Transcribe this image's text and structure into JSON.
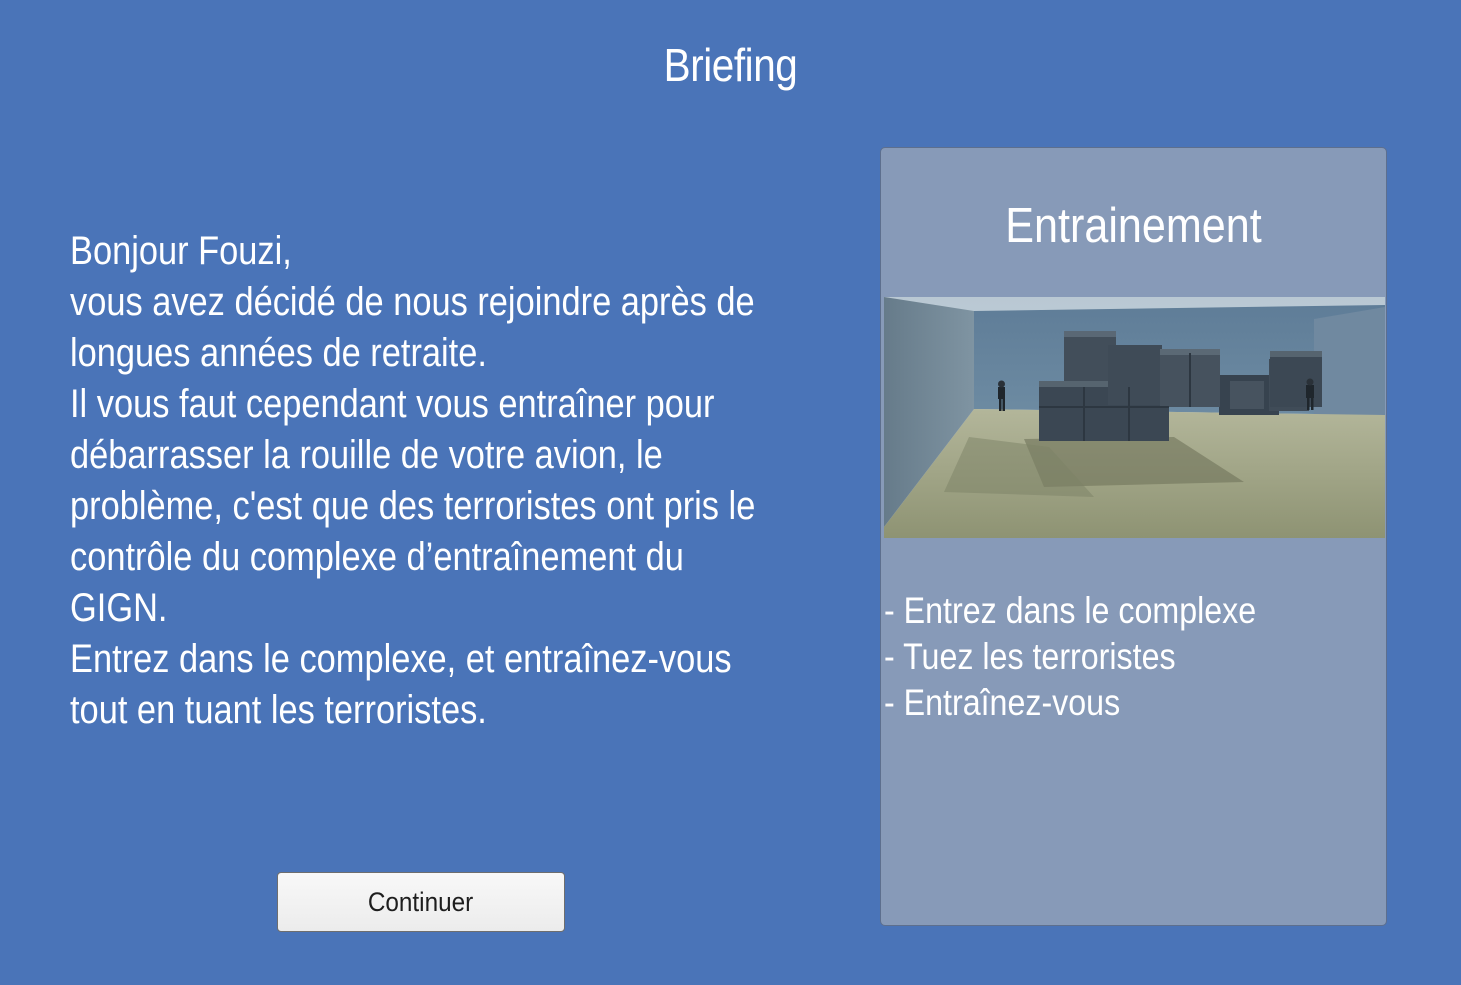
{
  "screen": {
    "title": "Briefing"
  },
  "briefing": {
    "text": "Bonjour Fouzi,\n vous avez décidé de nous rejoindre après de longues années de retraite.\nIl vous faut cependant vous entraîner pour débarrasser la rouille de votre avion, le problème, c'est que des terroristes ont pris le contrôle du complexe d’entraînement du GIGN.\nEntrez dans le complexe, et entraînez-vous tout en tuant les terroristes."
  },
  "continue_button": {
    "label": "Continuer"
  },
  "mission": {
    "title": "Entrainement",
    "image_icon": "training-complex-preview",
    "objectives": [
      "- Entrez dans le complexe",
      "- Tuez les terroristes",
      "- Entraînez-vous"
    ]
  },
  "colors": {
    "background": "#4a74b8",
    "panel": "#879ab8",
    "button": "#f2f2f2"
  }
}
